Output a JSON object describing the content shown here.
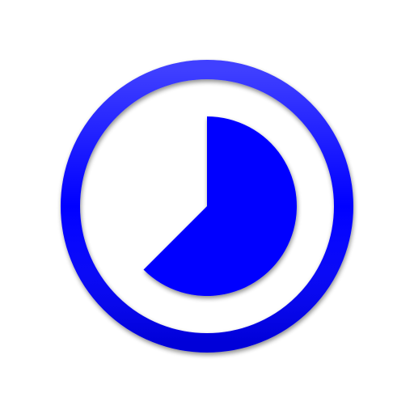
{
  "icon": {
    "name": "timer-progress-icon",
    "color": "#0000ff",
    "progress_fraction": 0.625
  }
}
